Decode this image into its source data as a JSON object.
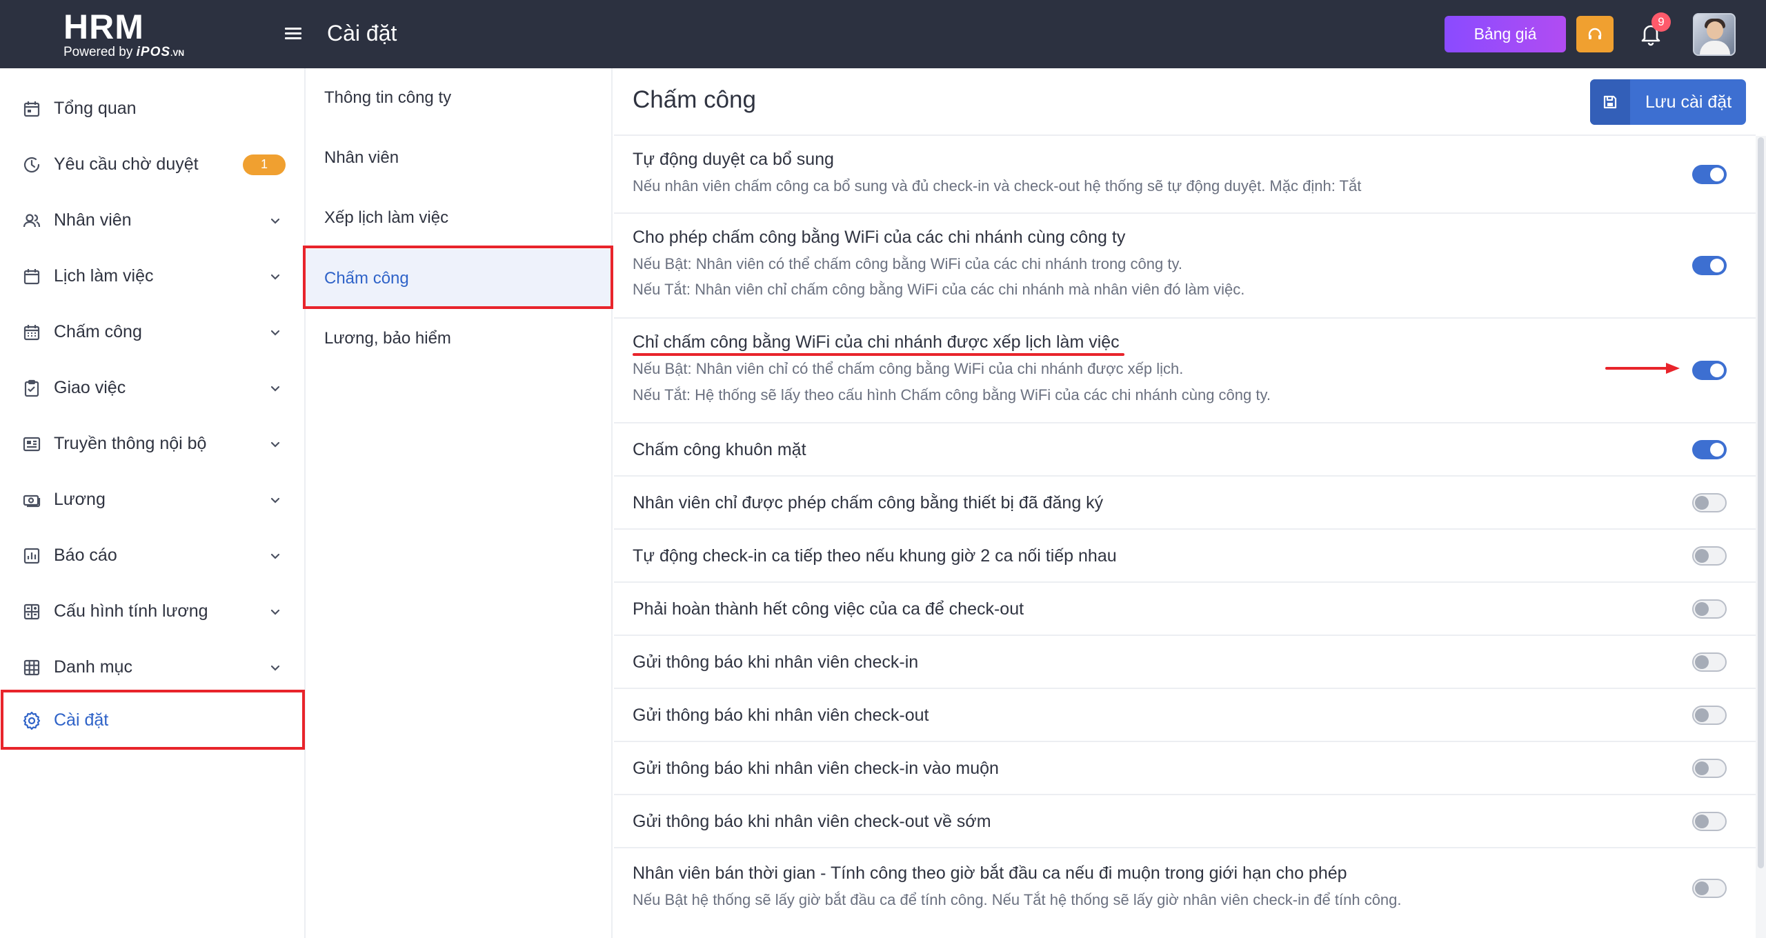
{
  "brand": {
    "name": "HRM",
    "powered_by": "Powered by",
    "powered_brand": "iPOS",
    "powered_tld": ".VN"
  },
  "header": {
    "title": "Cài đặt",
    "pricing_label": "Bảng giá",
    "notification_count": "9",
    "support_icon": "headset-icon",
    "bell_icon": "bell-icon"
  },
  "sidebar": {
    "items": [
      {
        "label": "Tổng quan",
        "icon": "calendar-icon"
      },
      {
        "label": "Yêu cầu chờ duyệt",
        "icon": "clock-icon",
        "badge": "1"
      },
      {
        "label": "Nhân viên",
        "icon": "users-icon"
      },
      {
        "label": "Lịch làm việc",
        "icon": "calendar-icon"
      },
      {
        "label": "Chấm công",
        "icon": "calendar-grid-icon"
      },
      {
        "label": "Giao việc",
        "icon": "clipboard-check-icon"
      },
      {
        "label": "Truyền thông nội bộ",
        "icon": "newspaper-icon"
      },
      {
        "label": "Lương",
        "icon": "money-icon"
      },
      {
        "label": "Báo cáo",
        "icon": "bar-chart-icon"
      },
      {
        "label": "Cấu hình tính lương",
        "icon": "calculator-icon"
      },
      {
        "label": "Danh mục",
        "icon": "grid-icon"
      },
      {
        "label": "Cài đặt",
        "icon": "gear-icon"
      }
    ],
    "active_index": 11
  },
  "subnav": {
    "items": [
      {
        "label": "Thông tin công ty"
      },
      {
        "label": "Nhân viên"
      },
      {
        "label": "Xếp lịch làm việc"
      },
      {
        "label": "Chấm công"
      },
      {
        "label": "Lương, bảo hiểm"
      }
    ],
    "active_index": 3
  },
  "main": {
    "title": "Chấm công",
    "save_label": "Lưu cài đặt",
    "settings": [
      {
        "title": "Tự động duyệt ca bổ sung",
        "desc": [
          "Nếu nhân viên chấm công ca bổ sung và đủ check-in và check-out hệ thống sẽ tự động duyệt. Mặc định: Tắt"
        ],
        "enabled": true
      },
      {
        "title": "Cho phép chấm công bằng WiFi của các chi nhánh cùng công ty",
        "desc": [
          "Nếu Bật: Nhân viên có thể chấm công bằng WiFi của các chi nhánh trong công ty.",
          "Nếu Tắt: Nhân viên chỉ chấm công bằng WiFi của các chi nhánh mà nhân viên đó làm việc."
        ],
        "enabled": true
      },
      {
        "title": "Chỉ chấm công bằng WiFi của chi nhánh được xếp lịch làm việc",
        "desc": [
          "Nếu Bật: Nhân viên chỉ có thể chấm công bằng WiFi của chi nhánh được xếp lịch.",
          "Nếu Tắt: Hệ thống sẽ lấy theo cấu hình Chấm công bằng WiFi của các chi nhánh cùng công ty."
        ],
        "enabled": true
      },
      {
        "title": "Chấm công khuôn mặt",
        "desc": [],
        "enabled": true
      },
      {
        "title": "Nhân viên chỉ được phép chấm công bằng thiết bị đã đăng ký",
        "desc": [],
        "enabled": false
      },
      {
        "title": "Tự động check-in ca tiếp theo nếu khung giờ 2 ca nối tiếp nhau",
        "desc": [],
        "enabled": false
      },
      {
        "title": "Phải hoàn thành hết công việc của ca để check-out",
        "desc": [],
        "enabled": false
      },
      {
        "title": "Gửi thông báo khi nhân viên check-in",
        "desc": [],
        "enabled": false
      },
      {
        "title": "Gửi thông báo khi nhân viên check-out",
        "desc": [],
        "enabled": false
      },
      {
        "title": "Gửi thông báo khi nhân viên check-in vào muộn",
        "desc": [],
        "enabled": false
      },
      {
        "title": "Gửi thông báo khi nhân viên check-out về sớm",
        "desc": [],
        "enabled": false
      },
      {
        "title": "Nhân viên bán thời gian - Tính công theo giờ bắt đầu ca nếu đi muộn trong giới hạn cho phép",
        "desc": [
          "Nếu Bật hệ thống sẽ lấy giờ bắt đầu ca để tính công. Nếu Tắt hệ thống sẽ lấy giờ nhân viên check-in để tính công."
        ],
        "enabled": false
      }
    ]
  },
  "colors": {
    "topbar": "#2c3140",
    "accent": "#3d6fd1",
    "annotation_red": "#e8242b",
    "badge_orange": "#f0a030",
    "pricing_purple": "#8a4bff"
  }
}
